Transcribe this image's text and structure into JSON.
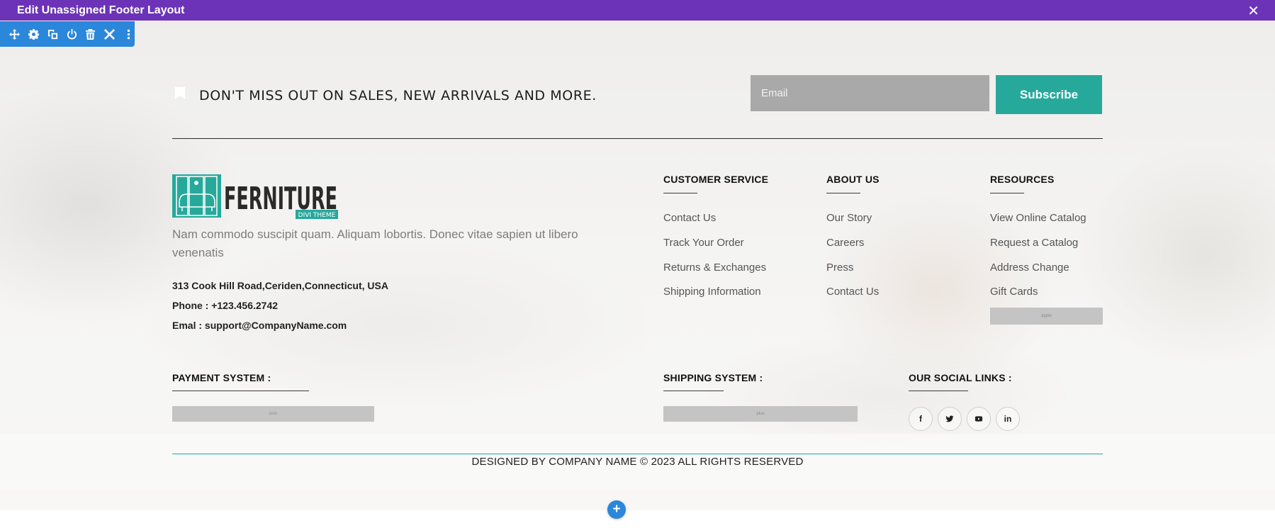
{
  "topbar": {
    "title": "Edit Unassigned Footer Layout",
    "close_icon": "close-icon"
  },
  "toolbar": {
    "icons": [
      "move-icon",
      "gear-icon",
      "duplicate-icon",
      "power-icon",
      "trash-icon",
      "close-icon",
      "more-icon"
    ]
  },
  "newsletter": {
    "icon": "bookmark-icon",
    "text": "DON'T MISS OUT ON SALES, NEW ARRIVALS AND MORE.",
    "email_placeholder": "Email",
    "subscribe_label": "Subscribe"
  },
  "brand": {
    "logo_name": "FERNITURE",
    "logo_tagline": "DIVI THEME",
    "description": "Nam commodo suscipit quam. Aliquam lobortis. Donec vitae sapien ut libero venenatis",
    "address": "313 Cook Hill Road,Ceriden,Connecticut, USA",
    "phone": "Phone : +123.456.2742",
    "email": "Emal : support@CompanyName.com"
  },
  "columns": {
    "customer_service": {
      "heading": "CUSTOMER SERVICE",
      "links": [
        "Contact Us",
        "Track Your Order",
        "Returns & Exchanges",
        "Shipping Information"
      ]
    },
    "about_us": {
      "heading": "ABOUT US",
      "links": [
        "Our Story",
        "Careers",
        "Press",
        "Contact Us"
      ]
    },
    "resources": {
      "heading": "RESOURCES",
      "links": [
        "View Online Catalog",
        "Request a Catalog",
        "Address Change",
        "Gift Cards"
      ],
      "placeholder_text": "appie"
    }
  },
  "payment": {
    "heading": "PAYMENT SYSTEM :",
    "placeholder_text": "icon"
  },
  "shipping": {
    "heading": "SHIPPING SYSTEM :",
    "placeholder_text": "plus"
  },
  "social": {
    "heading": "OUR SOCIAL LINKS :",
    "icons": [
      "facebook-icon",
      "twitter-icon",
      "youtube-icon",
      "linkedin-icon"
    ]
  },
  "footer": {
    "copyright": "DESIGNED BY COMPANY NAME © 2023 ALL RIGHTS RESERVED",
    "add_label": "+"
  },
  "colors": {
    "topbar": "#6c33b8",
    "toolbar": "#2b87da",
    "accent": "#26a99b",
    "input": "#a9a9a9"
  }
}
